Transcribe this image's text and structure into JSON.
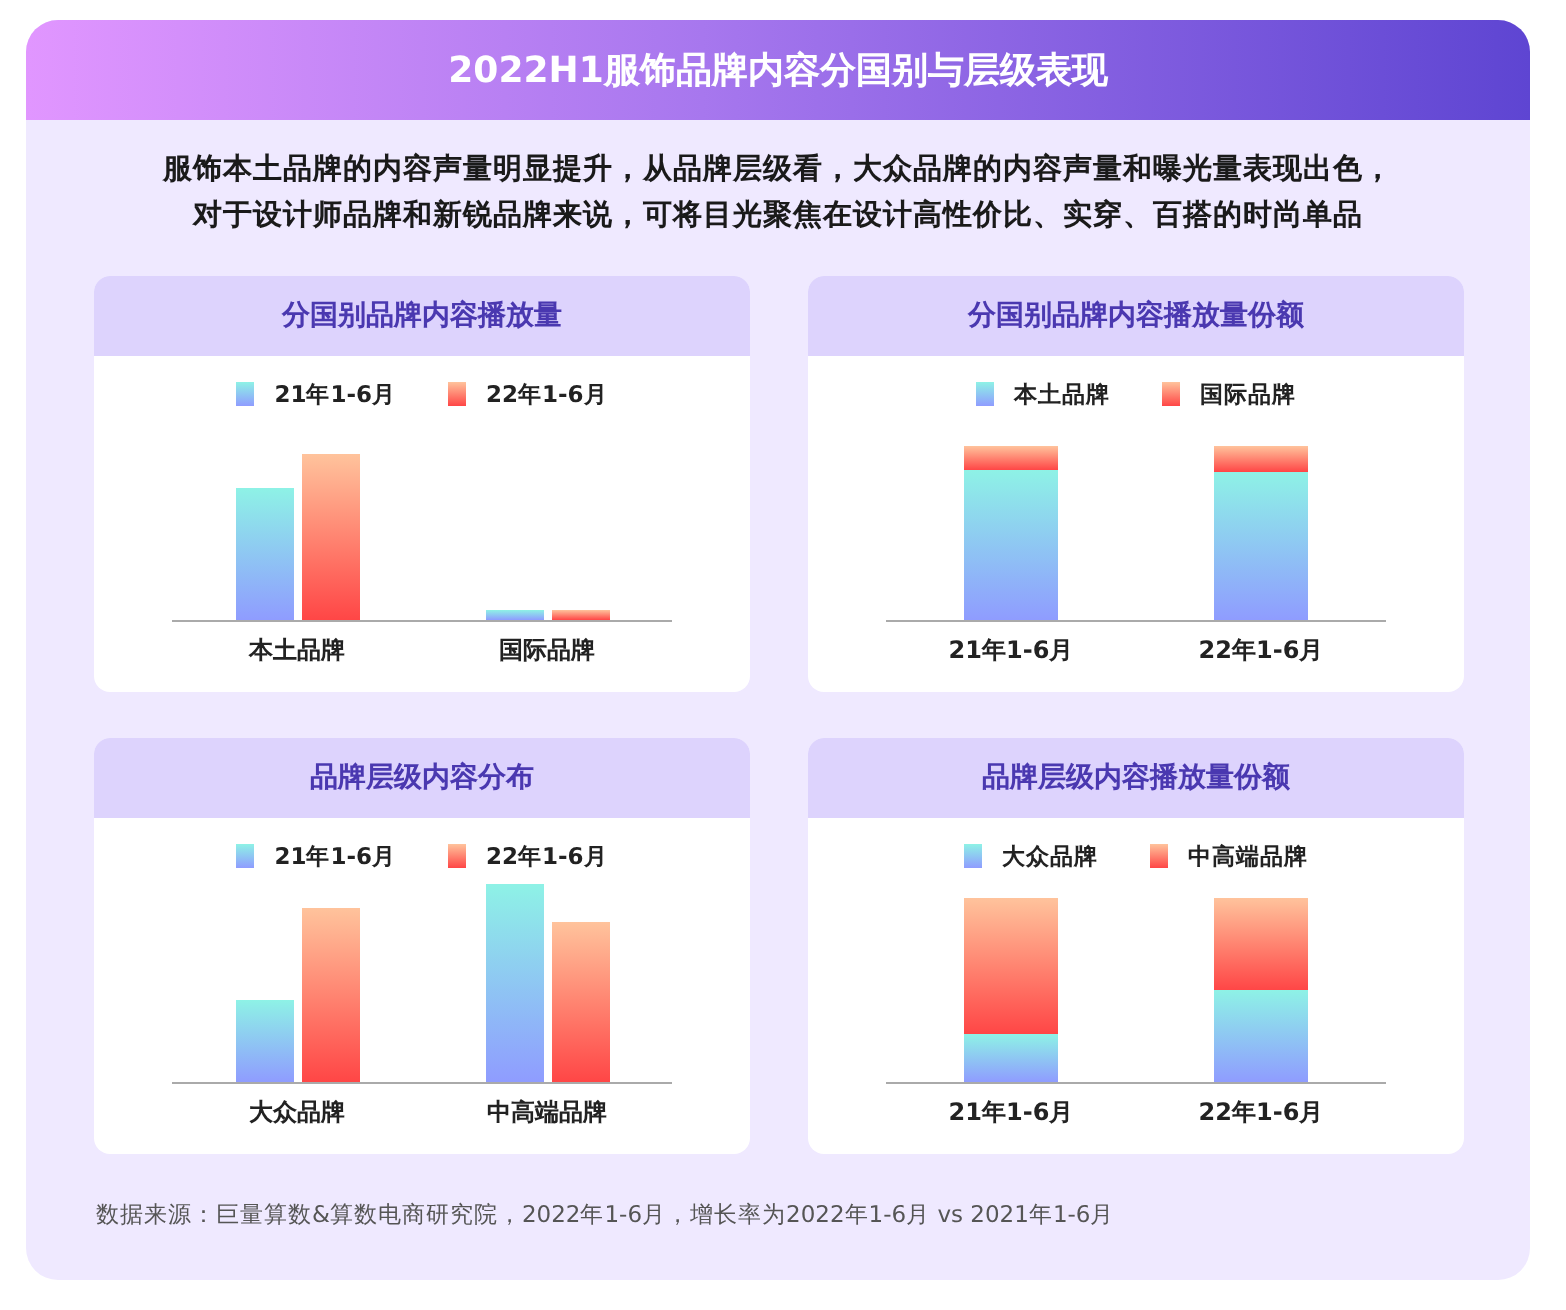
{
  "title": "2022H1服饰品牌内容分国别与层级表现",
  "summary": [
    "服饰本土品牌的内容声量明显提升，从品牌层级看，大众品牌的内容声量和曝光量表现出色，",
    "对于设计师品牌和新锐品牌来说，可将目光聚焦在设计高性价比、实穿、百搭的时尚单品"
  ],
  "panels": [
    {
      "title": "分国别品牌内容播放量",
      "kind": "grouped",
      "legend": [
        {
          "label": "21年1-6月",
          "kind": "cool"
        },
        {
          "label": "22年1-6月",
          "kind": "warm"
        }
      ],
      "categories": [
        "本土品牌",
        "国际品牌"
      ]
    },
    {
      "title": "分国别品牌内容播放量份额",
      "kind": "stacked",
      "legend": [
        {
          "label": "本土品牌",
          "kind": "cool"
        },
        {
          "label": "国际品牌",
          "kind": "warm"
        }
      ],
      "categories": [
        "21年1-6月",
        "22年1-6月"
      ]
    },
    {
      "title": "品牌层级内容分布",
      "kind": "grouped",
      "legend": [
        {
          "label": "21年1-6月",
          "kind": "cool"
        },
        {
          "label": "22年1-6月",
          "kind": "warm"
        }
      ],
      "categories": [
        "大众品牌",
        "中高端品牌"
      ]
    },
    {
      "title": "品牌层级内容播放量份额",
      "kind": "stacked",
      "legend": [
        {
          "label": "大众品牌",
          "kind": "cool"
        },
        {
          "label": "中高端品牌",
          "kind": "warm"
        }
      ],
      "categories": [
        "21年1-6月",
        "22年1-6月"
      ]
    }
  ],
  "footnote": "数据来源：巨量算数&算数电商研究院，2022年1-6月，增长率为2022年1-6月 vs 2021年1-6月"
}
